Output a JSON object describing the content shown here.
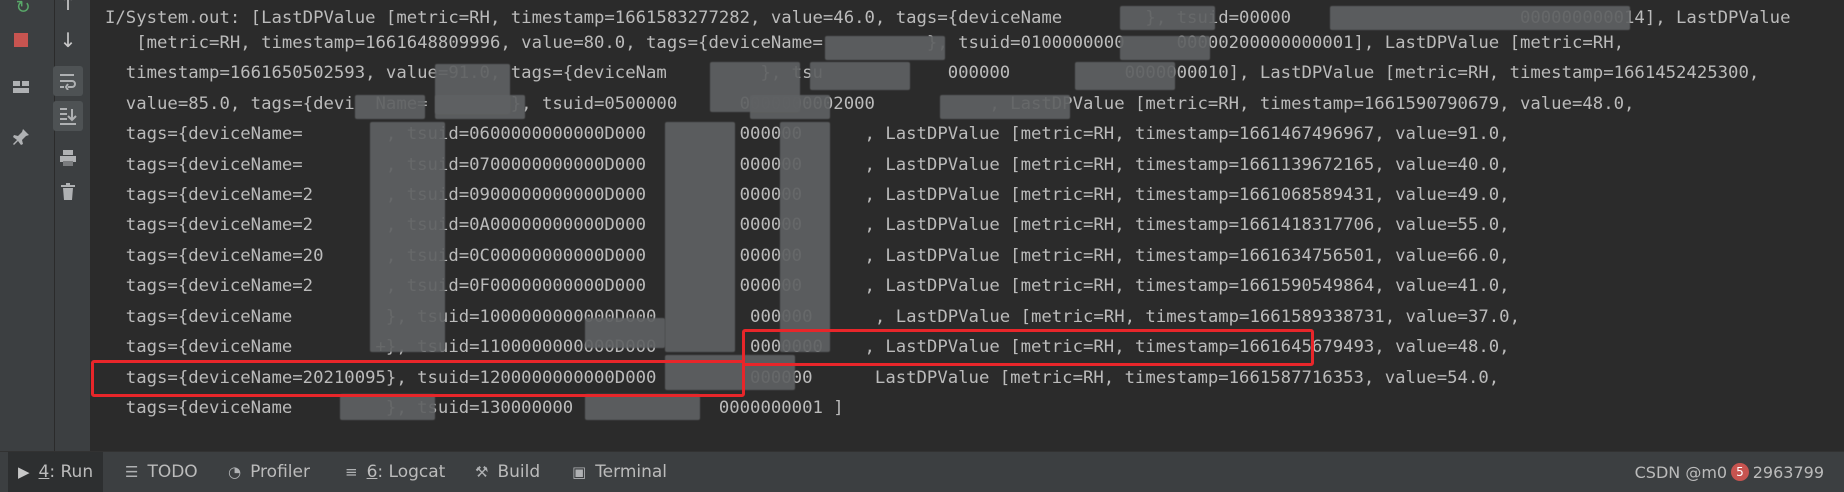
{
  "console": {
    "lines": [
      "I/System.out: [LastDPValue [metric=RH, timestamp=1661583277282, value=46.0, tags={deviceName        }, tsuid=00000                      000000000014], LastDPValue",
      "   [metric=RH, timestamp=1661648809996, value=80.0, tags={deviceName=          }, tsuid=0100000000     00000200000000001], LastDPValue [metric=RH,",
      "  timestamp=1661650502593, value=91.0, tags={deviceNam         }, tsu            000000           0000000010], LastDPValue [metric=RH, timestamp=1661452425300,",
      "  value=85.0, tags={devi  Name=        }, tsuid=0500000      0000000002000           , LastDPValue [metric=RH, timestamp=1661590790679, value=48.0,",
      "  tags={deviceName=        , tsuid=0600000000000D000         000000      , LastDPValue [metric=RH, timestamp=1661467496967, value=91.0,",
      "  tags={deviceName=        , tsuid=0700000000000D000         000000      , LastDPValue [metric=RH, timestamp=1661139672165, value=40.0,",
      "  tags={deviceName=2       , tsuid=0900000000000D000         000000      , LastDPValue [metric=RH, timestamp=1661068589431, value=49.0,",
      "  tags={deviceName=2       , tsuid=0A00000000000D000         000000      , LastDPValue [metric=RH, timestamp=1661418317706, value=55.0,",
      "  tags={deviceName=20      , tsuid=0C00000000000D000         000000      , LastDPValue [metric=RH, timestamp=1661634756501, value=66.0,",
      "  tags={deviceName=2       , tsuid=0F00000000000D000         000000      , LastDPValue [metric=RH, timestamp=1661590549864, value=41.0,",
      "  tags={deviceName         }, tsuid=1000000000000D000         000000      , LastDPValue [metric=RH, timestamp=1661589338731, value=37.0,",
      "  tags={deviceName        +}, tsuid=1100000000000D000         0000000    , LastDPValue [metric=RH, timestamp=1661645679493, value=48.0,",
      "  tags={deviceName=20210095}, tsuid=1200000000000D000         000000      LastDPValue [metric=RH, timestamp=1661587716353, value=54.0,",
      "  tags={deviceName         }, tsuid=130000000              0000000001 ]"
    ]
  },
  "bottom_bar": {
    "run": {
      "num": "4",
      "text": ": Run"
    },
    "todo": "TODO",
    "profiler": "Profiler",
    "logcat": {
      "num": "6",
      "text": ": Logcat"
    },
    "build": "Build",
    "terminal": "Terminal"
  },
  "watermark": {
    "prefix": "CSDN @m0",
    "badge": "5",
    "suffix": "2963799"
  },
  "colors": {
    "background": "#2b2b2b",
    "text": "#bbbbbb",
    "highlight": "#e8262a",
    "toolbar": "#3c3f41"
  }
}
